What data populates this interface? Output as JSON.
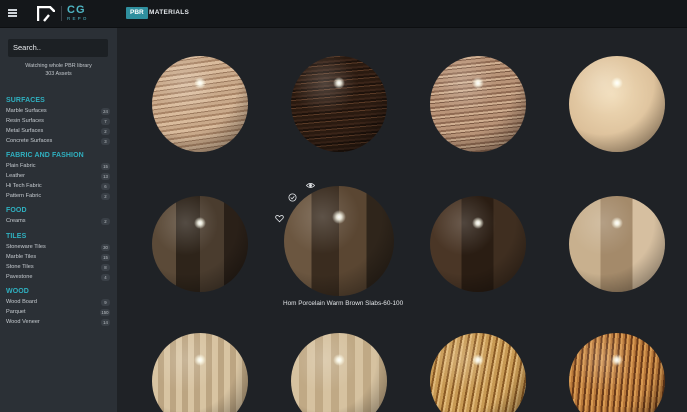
{
  "header": {
    "logo_text": "CG",
    "logo_sub": "REPO",
    "section_tag": "PBR",
    "section_title": "MATERIALS"
  },
  "sidebar": {
    "search_placeholder": "Search..",
    "watching_line1": "Watching whole PBR library",
    "watching_line2": "303 Assets",
    "categories": [
      {
        "title": "SURFACES",
        "items": [
          {
            "label": "Marble Surfaces",
            "count": "24"
          },
          {
            "label": "Resin Surfaces",
            "count": "7"
          },
          {
            "label": "Metal Surfaces",
            "count": "2"
          },
          {
            "label": "Concrete Surfaces",
            "count": "3"
          }
        ]
      },
      {
        "title": "FABRIC AND FASHION",
        "items": [
          {
            "label": "Plain Fabric",
            "count": "15"
          },
          {
            "label": "Leather",
            "count": "13"
          },
          {
            "label": "Hi Tech Fabric",
            "count": "6"
          },
          {
            "label": "Pattern Fabric",
            "count": "2"
          }
        ]
      },
      {
        "title": "FOOD",
        "items": [
          {
            "label": "Creams",
            "count": "2"
          }
        ]
      },
      {
        "title": "TILES",
        "items": [
          {
            "label": "Stoneware Tiles",
            "count": "30"
          },
          {
            "label": "Marble Tiles",
            "count": "15"
          },
          {
            "label": "Stone Tiles",
            "count": "8"
          },
          {
            "label": "Pavestone",
            "count": "4"
          }
        ]
      },
      {
        "title": "WOOD",
        "items": [
          {
            "label": "Wood Board",
            "count": "9"
          },
          {
            "label": "Parquet",
            "count": "150"
          },
          {
            "label": "Wood Veneer",
            "count": "14"
          }
        ]
      }
    ]
  },
  "grid": {
    "hovered_caption": "Hom Porcelain Warm Brown Slabs-60-100",
    "hover_icons": [
      "eye-icon",
      "check-circle-icon",
      "heart-icon"
    ]
  },
  "colors": {
    "accent": "#2fb0c0",
    "tag_bg": "#2f8f9e",
    "sidebar_bg": "#2b3036",
    "main_bg": "#1f2226"
  }
}
